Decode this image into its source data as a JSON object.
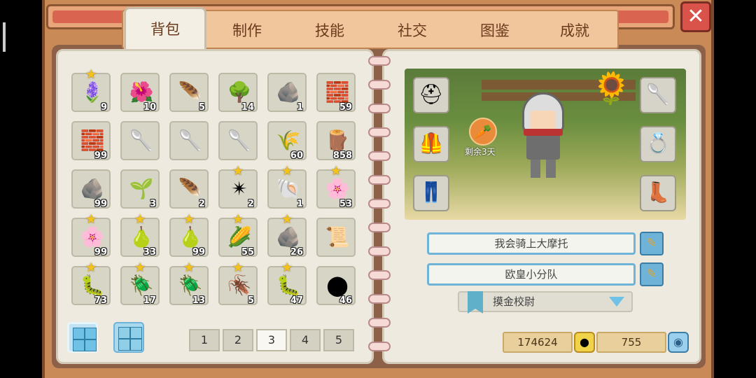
{
  "tabs": [
    "背包",
    "制作",
    "技能",
    "社交",
    "图鉴",
    "成就"
  ],
  "active_tab": 0,
  "close_icon": "close-x-icon",
  "inventory": [
    {
      "icon": "lavender-plant-icon",
      "glyph": "🪻",
      "count": "9",
      "star": true
    },
    {
      "icon": "red-flower-icon",
      "glyph": "🌺",
      "count": "10",
      "star": false
    },
    {
      "icon": "feather-quill-icon",
      "glyph": "🪶",
      "count": "5",
      "star": false
    },
    {
      "icon": "blue-tree-icon",
      "glyph": "🌳",
      "count": "14",
      "star": false
    },
    {
      "icon": "pebble-icon",
      "glyph": "🪨",
      "count": "1",
      "star": false
    },
    {
      "icon": "brick-icon",
      "glyph": "🧱",
      "count": "59",
      "star": false
    },
    {
      "icon": "brick-icon",
      "glyph": "🧱",
      "count": "99",
      "star": false
    },
    {
      "icon": "spoon-icon",
      "glyph": "🥄",
      "count": "",
      "star": false
    },
    {
      "icon": "spoon-icon",
      "glyph": "🥄",
      "count": "",
      "star": false
    },
    {
      "icon": "spoon-icon",
      "glyph": "🥄",
      "count": "",
      "star": false
    },
    {
      "icon": "wheat-bundle-icon",
      "glyph": "🌾",
      "count": "60",
      "star": false
    },
    {
      "icon": "wood-branch-icon",
      "glyph": "🪵",
      "count": "858",
      "star": false
    },
    {
      "icon": "stone-icon",
      "glyph": "🪨",
      "count": "99",
      "star": false
    },
    {
      "icon": "seeds-icon",
      "glyph": "🌱",
      "count": "3",
      "star": false
    },
    {
      "icon": "white-feather-icon",
      "glyph": "🪶",
      "count": "2",
      "star": false
    },
    {
      "icon": "sea-urchin-icon",
      "glyph": "✴",
      "count": "2",
      "star": true
    },
    {
      "icon": "seashell-icon",
      "glyph": "🐚",
      "count": "1",
      "star": true
    },
    {
      "icon": "peach-blossom-icon",
      "glyph": "🌸",
      "count": "53",
      "star": true
    },
    {
      "icon": "peach-blossom-icon",
      "glyph": "🌸",
      "count": "99",
      "star": true
    },
    {
      "icon": "green-gourd-icon",
      "glyph": "🍐",
      "count": "33",
      "star": true
    },
    {
      "icon": "green-gourd-icon",
      "glyph": "🍐",
      "count": "99",
      "star": true
    },
    {
      "icon": "corn-icon",
      "glyph": "🌽",
      "count": "55",
      "star": true
    },
    {
      "icon": "ore-rock-icon",
      "glyph": "🪨",
      "count": "26",
      "star": true
    },
    {
      "icon": "parchment-icon",
      "glyph": "📜",
      "count": "",
      "star": false
    },
    {
      "icon": "caterpillar-icon",
      "glyph": "🐛",
      "count": "73",
      "star": true
    },
    {
      "icon": "purple-beetle-icon",
      "glyph": "🪲",
      "count": "17",
      "star": true
    },
    {
      "icon": "green-beetle-icon",
      "glyph": "🪲",
      "count": "13",
      "star": true
    },
    {
      "icon": "brown-beetle-icon",
      "glyph": "🪳",
      "count": "5",
      "star": true
    },
    {
      "icon": "grub-icon",
      "glyph": "🐛",
      "count": "47",
      "star": true
    },
    {
      "icon": "coal-icon",
      "glyph": "⬤",
      "count": "46",
      "star": false
    }
  ],
  "pages": [
    "1",
    "2",
    "3",
    "4",
    "5"
  ],
  "active_page": 2,
  "character": {
    "buff_label": "剩余3天",
    "left_equipment": [
      "helmet-icon",
      "chest-armor-icon",
      "pants-icon"
    ],
    "right_equipment": [
      "spoon-tool-icon",
      "amethyst-ring-icon",
      "red-boots-icon"
    ]
  },
  "name_field": "我会骑上大摩托",
  "group_field": "欧皇小分队",
  "title_select": "摸金校尉",
  "gold": "174624",
  "gems": "755",
  "colors": {
    "frame": "#c98a57",
    "page": "#efeadf",
    "accent_blue": "#6fb4d8"
  }
}
